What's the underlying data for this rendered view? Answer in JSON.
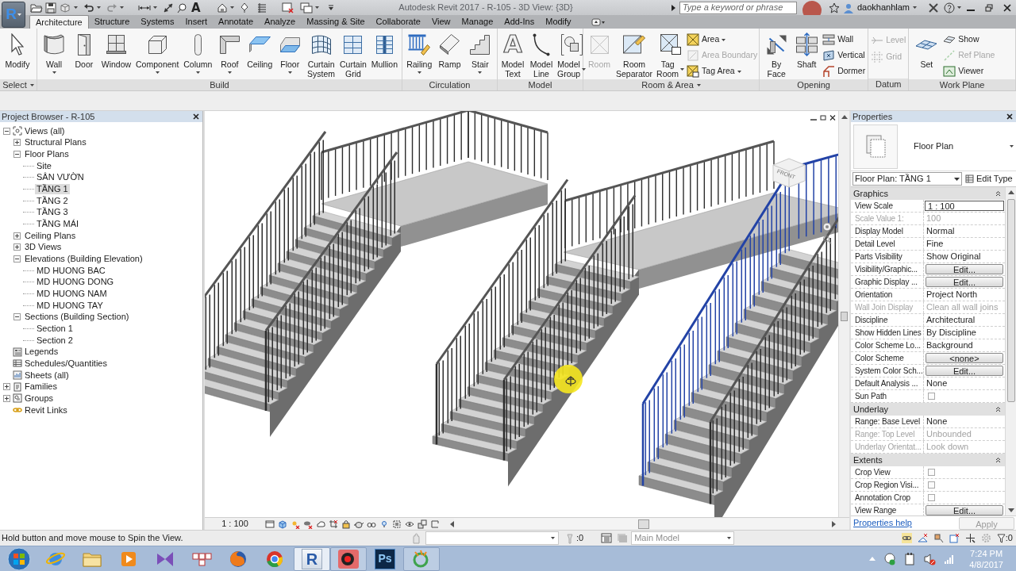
{
  "app_button": {
    "label": "R"
  },
  "quick_access": {
    "text_tool": "A"
  },
  "window": {
    "title": "Autodesk Revit 2017 - R-105 - 3D View: {3D}"
  },
  "search": {
    "placeholder": "Type a keyword or phrase"
  },
  "user": {
    "name": "daokhanhlam"
  },
  "tabs": [
    {
      "label": "Architecture",
      "selected": true
    },
    {
      "label": "Structure",
      "selected": false
    },
    {
      "label": "Systems",
      "selected": false
    },
    {
      "label": "Insert",
      "selected": false
    },
    {
      "label": "Annotate",
      "selected": false
    },
    {
      "label": "Analyze",
      "selected": false
    },
    {
      "label": "Massing & Site",
      "selected": false
    },
    {
      "label": "Collaborate",
      "selected": false
    },
    {
      "label": "View",
      "selected": false
    },
    {
      "label": "Manage",
      "selected": false
    },
    {
      "label": "Add-Ins",
      "selected": false
    },
    {
      "label": "Modify",
      "selected": false
    }
  ],
  "ribbon": [
    {
      "title": "Select",
      "dropdown": true,
      "tools": [
        {
          "kind": "large",
          "label": "Modify",
          "disabled": false
        }
      ]
    },
    {
      "title": "Build",
      "dropdown": false,
      "tools": [
        {
          "kind": "split",
          "label": "Wall",
          "disabled": false
        },
        {
          "kind": "large",
          "label": "Door",
          "disabled": false
        },
        {
          "kind": "large",
          "label": "Window",
          "disabled": false
        },
        {
          "kind": "split",
          "label": "Component",
          "disabled": false
        },
        {
          "kind": "split",
          "label": "Column",
          "disabled": false
        },
        {
          "kind": "split",
          "label": "Roof",
          "disabled": false
        },
        {
          "kind": "large",
          "label": "Ceiling",
          "disabled": false
        },
        {
          "kind": "split",
          "label": "Floor",
          "disabled": false
        },
        {
          "kind": "large",
          "label": "Curtain System",
          "disabled": false
        },
        {
          "kind": "large",
          "label": "Curtain Grid",
          "disabled": false
        },
        {
          "kind": "large",
          "label": "Mullion",
          "disabled": false
        }
      ]
    },
    {
      "title": "Circulation",
      "dropdown": false,
      "tools": [
        {
          "kind": "split",
          "label": "Railing",
          "disabled": false
        },
        {
          "kind": "large",
          "label": "Ramp",
          "disabled": false
        },
        {
          "kind": "split",
          "label": "Stair",
          "disabled": false
        }
      ]
    },
    {
      "title": "Model",
      "dropdown": false,
      "tools": [
        {
          "kind": "large",
          "label": "Model Text",
          "glyph": "A",
          "disabled": false
        },
        {
          "kind": "large",
          "label": "Model Line",
          "disabled": false
        },
        {
          "kind": "sidesplit",
          "label": "Model Group",
          "disabled": false
        }
      ]
    },
    {
      "title": "Room & Area",
      "dropdown": true,
      "tools": [
        {
          "kind": "large",
          "label": "Room",
          "disabled": true
        },
        {
          "kind": "large",
          "label": "Room Separator",
          "disabled": false
        },
        {
          "kind": "sidesplit",
          "label": "Tag Room",
          "disabled": false
        },
        {
          "kind": "smallsplit",
          "label": "Area",
          "disabled": false
        },
        {
          "kind": "small",
          "label": "Area Boundary",
          "disabled": true
        },
        {
          "kind": "smallsplit",
          "label": "Tag Area",
          "disabled": false
        }
      ]
    },
    {
      "title": "Opening",
      "dropdown": false,
      "tools": [
        {
          "kind": "large",
          "label": "By Face",
          "disabled": false
        },
        {
          "kind": "large",
          "label": "Shaft",
          "disabled": false
        },
        {
          "kind": "small",
          "label": "Wall",
          "disabled": false
        },
        {
          "kind": "small",
          "label": "Vertical",
          "disabled": false
        },
        {
          "kind": "small",
          "label": "Dormer",
          "disabled": false
        }
      ]
    },
    {
      "title": "Datum",
      "dropdown": false,
      "tools": [
        {
          "kind": "small",
          "label": "Level",
          "disabled": true
        },
        {
          "kind": "small",
          "label": "Grid",
          "disabled": true
        }
      ]
    },
    {
      "title": "Work Plane",
      "dropdown": false,
      "tools": [
        {
          "kind": "large",
          "label": "Set",
          "disabled": false
        },
        {
          "kind": "small",
          "label": "Show",
          "disabled": false
        },
        {
          "kind": "small",
          "label": "Ref Plane",
          "disabled": true
        },
        {
          "kind": "small",
          "label": "Viewer",
          "disabled": false
        }
      ]
    }
  ],
  "project_browser": {
    "title": "Project Browser - R-105",
    "tree": [
      {
        "label": "Views (all)",
        "expanded": true,
        "selected": false,
        "children": [
          {
            "label": "Structural Plans",
            "expanded": false,
            "selected": false
          },
          {
            "label": "Floor Plans",
            "expanded": true,
            "selected": false,
            "children": [
              {
                "label": "Site",
                "selected": false
              },
              {
                "label": "SÂN VƯỜN",
                "selected": false
              },
              {
                "label": "TẦNG 1",
                "selected": true
              },
              {
                "label": "TẦNG 2",
                "selected": false
              },
              {
                "label": "TẦNG 3",
                "selected": false
              },
              {
                "label": "TẦNG MÁI",
                "selected": false
              }
            ]
          },
          {
            "label": "Ceiling Plans",
            "expanded": false,
            "selected": false
          },
          {
            "label": "3D Views",
            "expanded": false,
            "selected": false
          },
          {
            "label": "Elevations (Building Elevation)",
            "expanded": true,
            "selected": false,
            "children": [
              {
                "label": "MD HUONG BAC",
                "selected": false
              },
              {
                "label": "MD HUONG DONG",
                "selected": false
              },
              {
                "label": "MD HUONG NAM",
                "selected": false
              },
              {
                "label": "MD HUONG TAY",
                "selected": false
              }
            ]
          },
          {
            "label": "Sections (Building Section)",
            "expanded": true,
            "selected": false,
            "children": [
              {
                "label": "Section 1",
                "selected": false
              },
              {
                "label": "Section 2",
                "selected": false
              }
            ]
          }
        ]
      },
      {
        "label": "Legends",
        "selected": false
      },
      {
        "label": "Schedules/Quantities",
        "selected": false
      },
      {
        "label": "Sheets (all)",
        "selected": false
      },
      {
        "label": "Families",
        "expanded": false,
        "selected": false
      },
      {
        "label": "Groups",
        "expanded": false,
        "selected": false
      },
      {
        "label": "Revit Links",
        "selected": false
      }
    ]
  },
  "viewport": {
    "view_cube": "FRONT",
    "railings": [
      {
        "selected": false
      },
      {
        "selected": false
      },
      {
        "selected": false
      },
      {
        "selected": false
      },
      {
        "selected": false
      },
      {
        "selected": false
      },
      {
        "selected": false
      },
      {
        "selected": true
      },
      {
        "selected": false
      }
    ],
    "scale": "1 : 100"
  },
  "properties": {
    "title": "Properties",
    "type": "Floor Plan",
    "instance": "Floor Plan: TẦNG 1",
    "edit_type": "Edit Type",
    "groups": [
      {
        "title": "Graphics",
        "expanded": true,
        "rows": [
          {
            "name": "View Scale",
            "kind": "input",
            "value": "1 : 100",
            "disabled": false
          },
          {
            "name": "Scale Value 1:",
            "kind": "text",
            "value": "100",
            "disabled": true
          },
          {
            "name": "Display Model",
            "kind": "text",
            "value": "Normal",
            "disabled": false
          },
          {
            "name": "Detail Level",
            "kind": "text",
            "value": "Fine",
            "disabled": false
          },
          {
            "name": "Parts Visibility",
            "kind": "text",
            "value": "Show Original",
            "disabled": false
          },
          {
            "name": "Visibility/Graphic...",
            "kind": "button",
            "value": "Edit...",
            "disabled": false
          },
          {
            "name": "Graphic Display ...",
            "kind": "button",
            "value": "Edit...",
            "disabled": false
          },
          {
            "name": "Orientation",
            "kind": "text",
            "value": "Project North",
            "disabled": false
          },
          {
            "name": "Wall Join Display",
            "kind": "text",
            "value": "Clean all wall joins",
            "disabled": true
          },
          {
            "name": "Discipline",
            "kind": "text",
            "value": "Architectural",
            "disabled": false
          },
          {
            "name": "Show Hidden Lines",
            "kind": "text",
            "value": "By Discipline",
            "disabled": false
          },
          {
            "name": "Color Scheme Lo...",
            "kind": "text",
            "value": "Background",
            "disabled": false
          },
          {
            "name": "Color Scheme",
            "kind": "button",
            "value": "<none>",
            "disabled": false
          },
          {
            "name": "System Color Sch...",
            "kind": "button",
            "value": "Edit...",
            "disabled": false
          },
          {
            "name": "Default Analysis ...",
            "kind": "text",
            "value": "None",
            "disabled": false
          },
          {
            "name": "Sun Path",
            "kind": "checkbox",
            "checked": false,
            "disabled": false
          }
        ]
      },
      {
        "title": "Underlay",
        "expanded": true,
        "rows": [
          {
            "name": "Range: Base Level",
            "kind": "text",
            "value": "None",
            "disabled": false
          },
          {
            "name": "Range: Top Level",
            "kind": "text",
            "value": "Unbounded",
            "disabled": true
          },
          {
            "name": "Underlay Orientat...",
            "kind": "text",
            "value": "Look down",
            "disabled": true
          }
        ]
      },
      {
        "title": "Extents",
        "expanded": true,
        "rows": [
          {
            "name": "Crop View",
            "kind": "checkbox",
            "checked": false,
            "disabled": false
          },
          {
            "name": "Crop Region Visi...",
            "kind": "checkbox",
            "checked": false,
            "disabled": false
          },
          {
            "name": "Annotation Crop",
            "kind": "checkbox",
            "checked": false,
            "disabled": false
          },
          {
            "name": "View Range",
            "kind": "button",
            "value": "Edit...",
            "disabled": false
          }
        ]
      }
    ],
    "help_link": "Properties help",
    "apply": {
      "label": "Apply",
      "disabled": true
    }
  },
  "status_bar": {
    "hint": "Hold button and move mouse to Spin the View.",
    "editable_count": ":0",
    "design_option": {
      "value": "Main Model",
      "disabled": true
    },
    "filter_count": ":0"
  },
  "taskbar": {
    "apps": [
      {
        "running": false,
        "selected": false
      },
      {
        "running": false,
        "selected": false
      },
      {
        "running": false,
        "selected": false
      },
      {
        "running": false,
        "selected": false
      },
      {
        "running": false,
        "selected": false
      },
      {
        "running": false,
        "selected": false
      },
      {
        "running": false,
        "selected": false
      },
      {
        "label": "R",
        "running": true,
        "selected": true
      },
      {
        "running": true,
        "selected": false
      },
      {
        "label": "Ps",
        "running": false,
        "selected": false
      },
      {
        "running": true,
        "selected": false
      }
    ],
    "clock": {
      "time": "7:24 PM",
      "date": "4/8/2017"
    }
  }
}
